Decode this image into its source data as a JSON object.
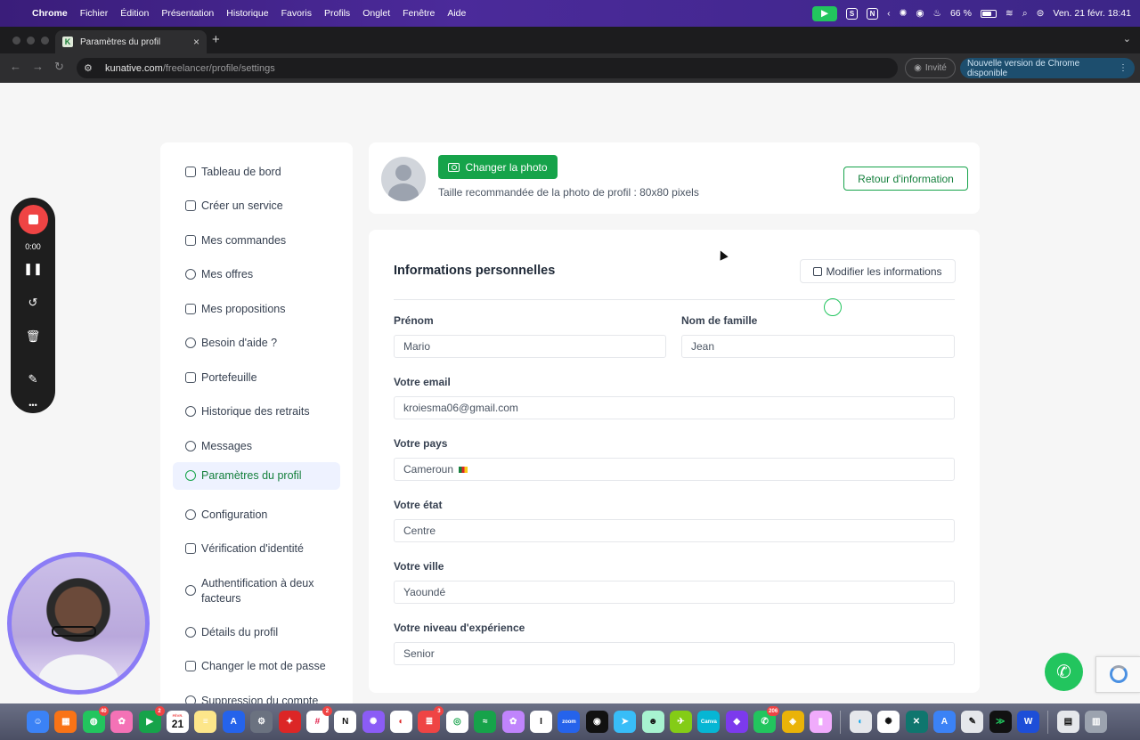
{
  "menubar": {
    "app": "Chrome",
    "items": [
      "Fichier",
      "Édition",
      "Présentation",
      "Historique",
      "Favoris",
      "Profils",
      "Onglet",
      "Fenêtre",
      "Aide"
    ],
    "battery": "66 %",
    "clock": "Ven. 21 févr. 18:41"
  },
  "browser": {
    "tab_title": "Paramètres du profil",
    "url_domain": "kunative.com",
    "url_path": "/freelancer/profile/settings",
    "guest_label": "Invité",
    "update_label": "Nouvelle version de Chrome disponible"
  },
  "sidebar": {
    "items": [
      {
        "label": "Tableau de bord"
      },
      {
        "label": "Créer un service"
      },
      {
        "label": "Mes commandes"
      },
      {
        "label": "Mes offres"
      },
      {
        "label": "Mes propositions"
      },
      {
        "label": "Besoin d'aide ?"
      },
      {
        "label": "Portefeuille"
      },
      {
        "label": "Historique des retraits"
      },
      {
        "label": "Messages"
      },
      {
        "label": "Paramètres du profil"
      },
      {
        "label": "Configuration"
      },
      {
        "label": "Vérification d'identité"
      },
      {
        "label": "Authentification à deux facteurs"
      },
      {
        "label": "Détails du profil"
      },
      {
        "label": "Changer le mot de passe"
      },
      {
        "label": "Suppression du compte"
      }
    ],
    "active": "Paramètres du profil"
  },
  "photo": {
    "change_label": "Changer la photo",
    "hint": "Taille recommandée de la photo de profil : 80x80 pixels",
    "back_label": "Retour d'information"
  },
  "info": {
    "title": "Informations personnelles",
    "edit_label": "Modifier les informations",
    "fields": {
      "first_name": {
        "label": "Prénom",
        "value": "Mario"
      },
      "last_name": {
        "label": "Nom de famille",
        "value": "Jean"
      },
      "email": {
        "label": "Votre email",
        "value": "kroiesma06@gmail.com"
      },
      "country": {
        "label": "Votre pays",
        "value": "Cameroun"
      },
      "state": {
        "label": "Votre état",
        "value": "Centre"
      },
      "city": {
        "label": "Votre ville",
        "value": "Yaoundé"
      },
      "experience": {
        "label": "Votre niveau d'expérience",
        "value": "Senior"
      }
    }
  },
  "recorder": {
    "time": "0:00"
  },
  "dock": {
    "calendar_month": "FÉVR.",
    "calendar_day": "21",
    "badges": {
      "messages": "40",
      "facetime": "2",
      "slack": "2",
      "todoist": "3",
      "whatsapp": "206"
    }
  },
  "colors": {
    "accent_green": "#16a34a",
    "active_bg": "#eef2ff"
  }
}
